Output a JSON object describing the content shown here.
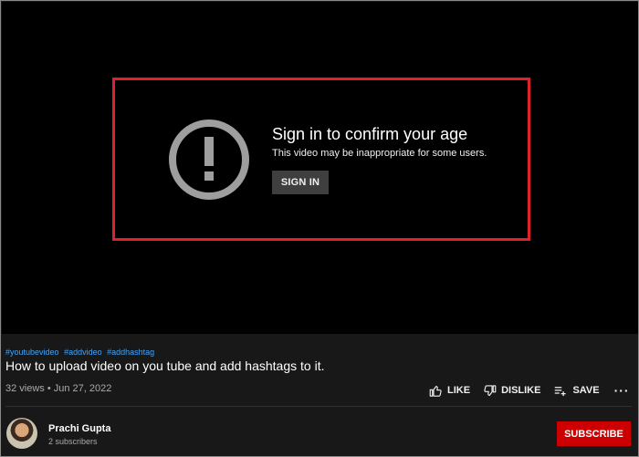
{
  "player": {
    "title": "Sign in to confirm your age",
    "subtitle": "This video may be inappropriate for some users.",
    "signin_label": "SIGN IN",
    "highlight_color": "#e0202a",
    "icon": "exclamation-circle-icon"
  },
  "video": {
    "hashtags": [
      "#youtubevideo",
      "#addvideo",
      "#addhashtag"
    ],
    "title": "How to upload video on you tube and add hashtags to it.",
    "stats": "32 views • Jun 27, 2022"
  },
  "actions": {
    "like_label": "LIKE",
    "dislike_label": "DISLIKE",
    "save_label": "SAVE",
    "more_label": "···"
  },
  "channel": {
    "name": "Prachi Gupta",
    "subscribers": "2 subscribers",
    "subscribe_label": "SUBSCRIBE",
    "subscribe_color": "#cc0000"
  }
}
